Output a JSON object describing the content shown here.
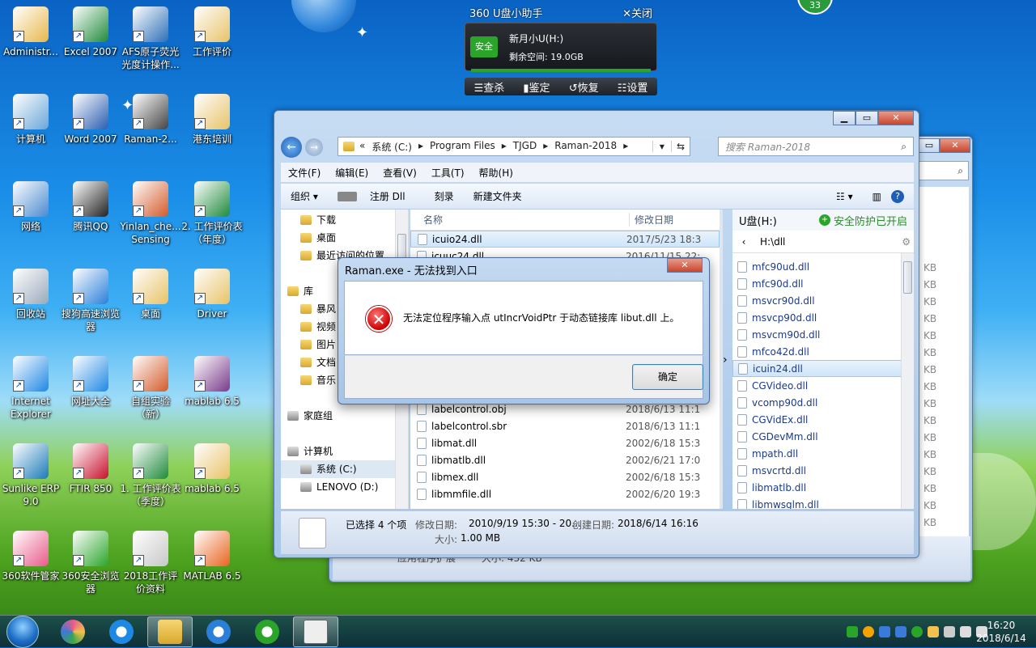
{
  "desktop": {
    "icons": [
      {
        "label": "Administr...",
        "color": "#e8b84a"
      },
      {
        "label": "Excel 2007",
        "color": "#1f8a3b"
      },
      {
        "label": "AFS原子荧光光度计操作...",
        "color": "#2d6fb8"
      },
      {
        "label": "工作评价",
        "color": "#e8c267"
      },
      {
        "label": "计算机",
        "color": "#6aa6d8"
      },
      {
        "label": "Word 2007",
        "color": "#2a5db0"
      },
      {
        "label": "Raman-2...",
        "color": "#444"
      },
      {
        "label": "港东培训",
        "color": "#e8c267"
      },
      {
        "label": "网络",
        "color": "#4a8ad0"
      },
      {
        "label": "腾讯QQ",
        "color": "#222"
      },
      {
        "label": "Yinlan_che... Sensing",
        "color": "#d35a2a"
      },
      {
        "label": "2. 工作评价表（年度）",
        "color": "#1f8a3b"
      },
      {
        "label": "回收站",
        "color": "#9ab"
      },
      {
        "label": "搜狗高速浏览器",
        "color": "#2b7fd9"
      },
      {
        "label": "桌面",
        "color": "#e8c267"
      },
      {
        "label": "Driver",
        "color": "#e8c267"
      },
      {
        "label": "Internet Explorer",
        "color": "#1e88e5"
      },
      {
        "label": "网址大全",
        "color": "#1e88e5"
      },
      {
        "label": "自组实验（新）",
        "color": "#d35a2a"
      },
      {
        "label": "mablab 6.5",
        "color": "#7a3a8a"
      },
      {
        "label": "Sunlike ERP 9.0",
        "color": "#1a7ab8"
      },
      {
        "label": "FTIR 850",
        "color": "#c8102e"
      },
      {
        "label": "1. 工作评价表（季度）",
        "color": "#1f8a3b"
      },
      {
        "label": "mablab 6.5",
        "color": "#e8c267"
      },
      {
        "label": "360软件管家",
        "color": "#e85a8a"
      },
      {
        "label": "360安全浏览器",
        "color": "#2aa52a"
      },
      {
        "label": "2018工作评价资料",
        "color": "#c8c8c8"
      },
      {
        "label": "MATLAB 6.5",
        "color": "#e8641e"
      }
    ]
  },
  "widget360": {
    "title": "360 U盘小助手",
    "close": "✕关闭",
    "safe_label": "安全",
    "drive_name": "新月小U(H:)",
    "free_space": "剩余空间: 19.0GB",
    "buttons": [
      "☰查杀",
      "▮鉴定",
      "↺恢复",
      "☷设置"
    ],
    "badge": "33"
  },
  "back_window": {
    "status_type": "应用程序扩展",
    "status_size": "大小: 432 KB",
    "sizes": [
      "KB",
      "KB",
      "KB",
      "KB",
      "KB",
      "KB",
      "KB",
      "KB",
      "KB",
      "KB",
      "KB",
      "KB",
      "KB",
      "KB",
      "KB",
      "KB"
    ]
  },
  "explorer": {
    "breadcrumb": [
      "«",
      "系统 (C:)",
      "Program Files",
      "TJGD",
      "Raman-2018"
    ],
    "search_placeholder": "搜索 Raman-2018",
    "menu": [
      "文件(F)",
      "编辑(E)",
      "查看(V)",
      "工具(T)",
      "帮助(H)"
    ],
    "commands": [
      "组织 ▾",
      "注册 Dll",
      "刻录",
      "新建文件夹"
    ],
    "nav": [
      {
        "label": "下载",
        "icon": "fold",
        "indent": 1
      },
      {
        "label": "桌面",
        "icon": "fold",
        "indent": 1
      },
      {
        "label": "最近访问的位置",
        "icon": "fold",
        "indent": 1
      },
      {
        "label": "",
        "icon": "",
        "indent": 0
      },
      {
        "label": "库",
        "icon": "fold",
        "indent": 0
      },
      {
        "label": "暴风",
        "icon": "fold",
        "indent": 1
      },
      {
        "label": "视频",
        "icon": "fold",
        "indent": 1
      },
      {
        "label": "图片",
        "icon": "fold",
        "indent": 1
      },
      {
        "label": "文档",
        "icon": "fold",
        "indent": 1
      },
      {
        "label": "音乐",
        "icon": "fold",
        "indent": 1
      },
      {
        "label": "",
        "icon": "",
        "indent": 0
      },
      {
        "label": "家庭组",
        "icon": "drv",
        "indent": 0
      },
      {
        "label": "",
        "icon": "",
        "indent": 0
      },
      {
        "label": "计算机",
        "icon": "drv",
        "indent": 0
      },
      {
        "label": "系统 (C:)",
        "icon": "drv",
        "indent": 1
      },
      {
        "label": "LENOVO (D:)",
        "icon": "drv",
        "indent": 1
      }
    ],
    "columns": {
      "name": "名称",
      "date": "修改日期"
    },
    "files": [
      {
        "name": "icuio24.dll",
        "date": "2017/5/23 18:3"
      },
      {
        "name": "icuuc24.dll",
        "date": "2016/11/15 22:"
      },
      {
        "name": "",
        "date": ""
      },
      {
        "name": "",
        "date": ""
      },
      {
        "name": "",
        "date": ""
      },
      {
        "name": "",
        "date": ""
      },
      {
        "name": "",
        "date": ""
      },
      {
        "name": "",
        "date": ""
      },
      {
        "name": "",
        "date": ""
      },
      {
        "name": "",
        "date": ""
      },
      {
        "name": "labelcontrol.obj",
        "date": "2018/6/13 11:1"
      },
      {
        "name": "labelcontrol.sbr",
        "date": "2018/6/13 11:1"
      },
      {
        "name": "libmat.dll",
        "date": "2002/6/18 15:3"
      },
      {
        "name": "libmatlb.dll",
        "date": "2002/6/21 17:0"
      },
      {
        "name": "libmex.dll",
        "date": "2002/6/18 15:3"
      },
      {
        "name": "libmmfile.dll",
        "date": "2002/6/20 19:3"
      }
    ],
    "usb_panel": {
      "title": "U盘(H:)",
      "protect": "安全防护已开启",
      "path": "H:\\dll",
      "files": [
        "mfc90ud.dll",
        "mfc90d.dll",
        "msvcr90d.dll",
        "msvcp90d.dll",
        "msvcm90d.dll",
        "mfco42d.dll",
        "icuin24.dll",
        "CGVideo.dll",
        "vcomp90d.dll",
        "CGVidEx.dll",
        "CGDevMm.dll",
        "mpath.dll",
        "msvcrtd.dll",
        "libmatlb.dll",
        "libmwsglm.dll"
      ]
    },
    "status": {
      "selected": "已选择 4 个项",
      "modified_label": "修改日期:",
      "modified_value": "2010/9/19 15:30 - 20...",
      "created_label": "创建日期:",
      "created_value": "2018/6/14 16:16",
      "size_label": "大小:",
      "size_value": "1.00 MB"
    }
  },
  "dialog": {
    "title": "Raman.exe - 无法找到入口",
    "message": "无法定位程序输入点 utIncrVoidPtr 于动态链接库 libut.dll 上。",
    "ok": "确定",
    "close": "✕"
  },
  "taskbar": {
    "time": "16:20",
    "date": "2018/6/14"
  }
}
